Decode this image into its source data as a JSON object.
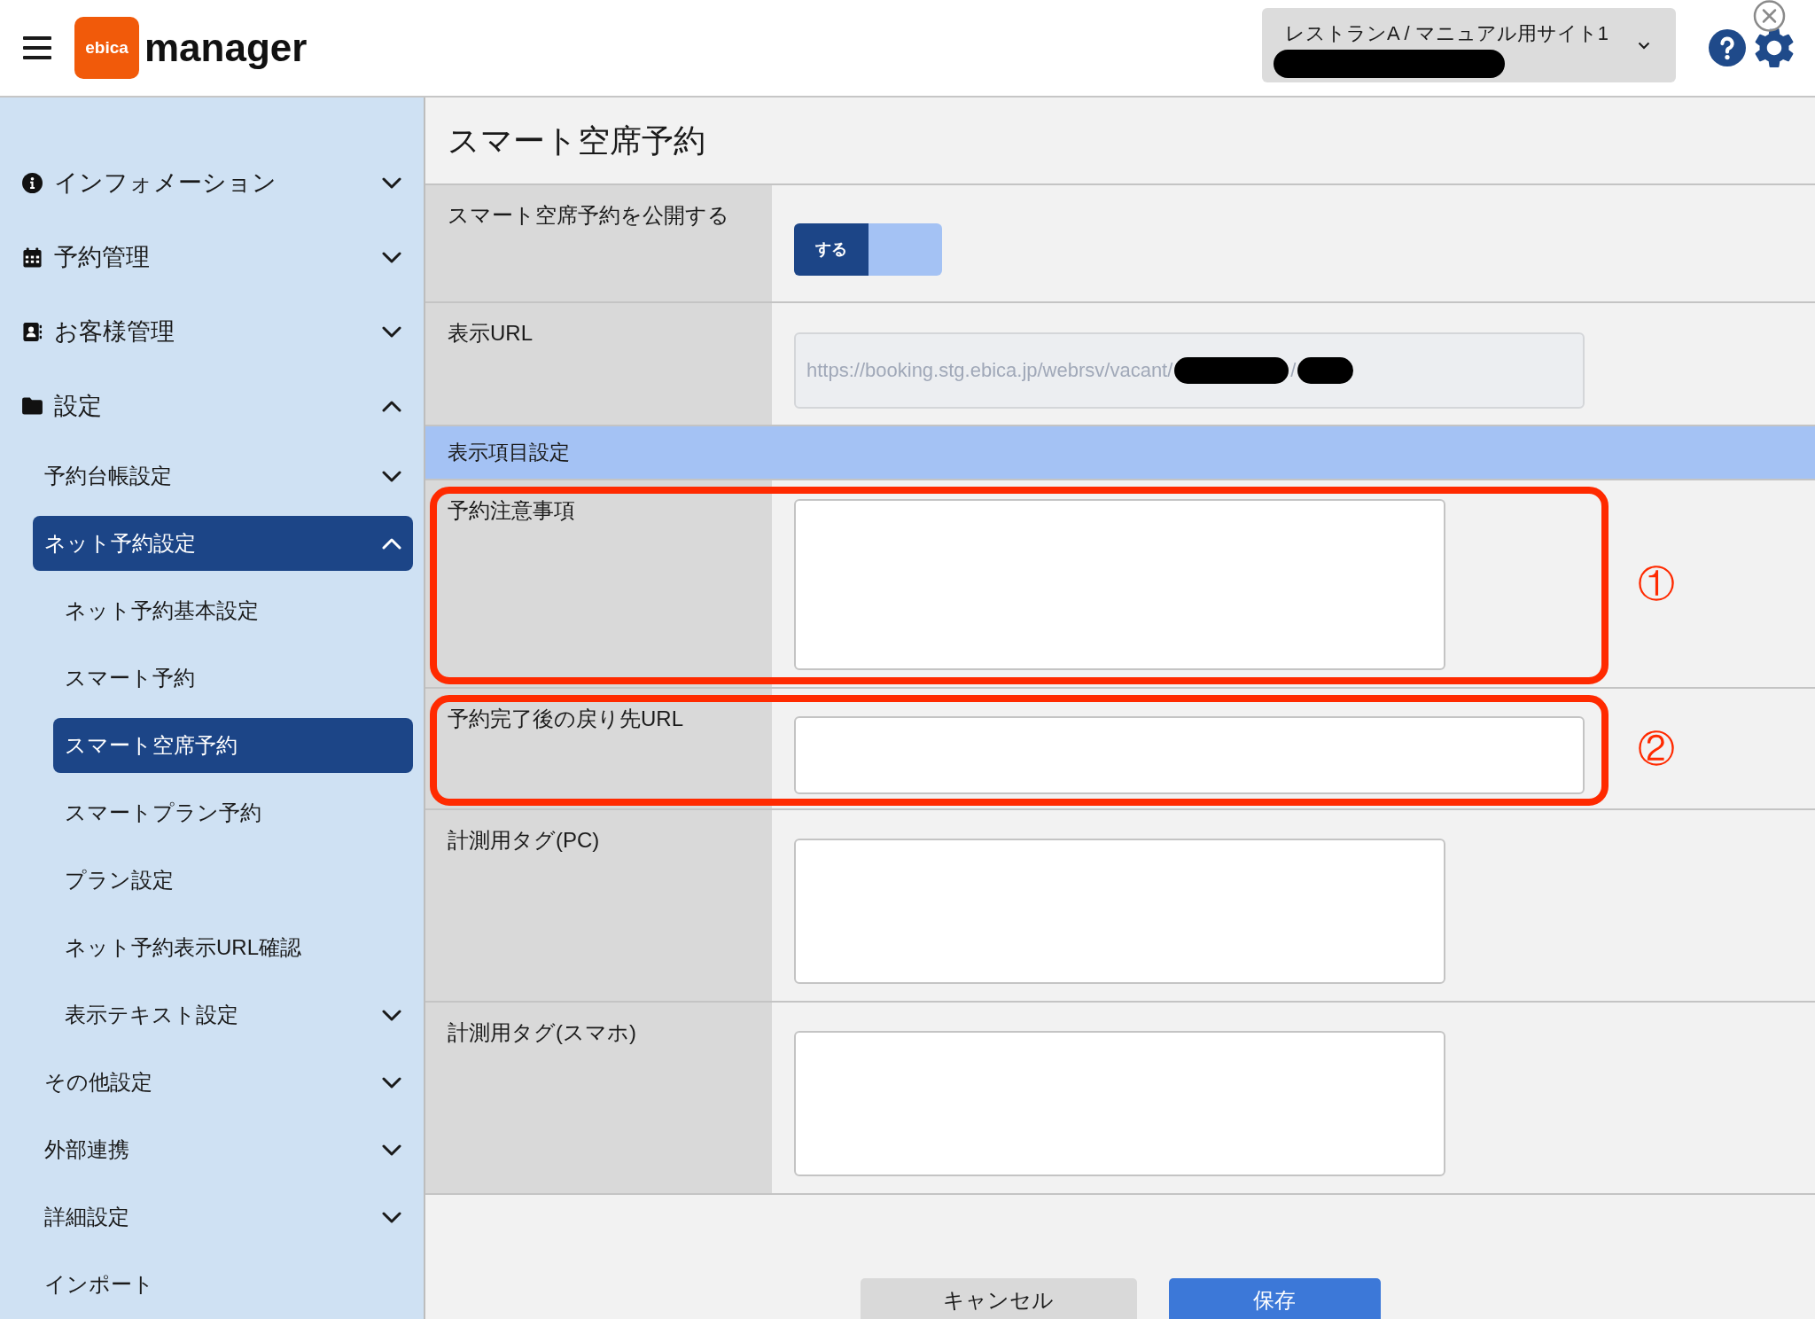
{
  "header": {
    "logo_text": "ebica",
    "app_name": "manager",
    "site_selector": {
      "label": "レストランA / マニュアル用サイト1",
      "redacted": true
    }
  },
  "sidebar": {
    "items": [
      {
        "label": "インフォメーション",
        "selected": false,
        "expanded": false
      },
      {
        "label": "予約管理",
        "selected": false,
        "expanded": false
      },
      {
        "label": "お客様管理",
        "selected": false,
        "expanded": false
      },
      {
        "label": "設定",
        "selected": false,
        "expanded": true,
        "children": [
          {
            "label": "予約台帳設定",
            "selected": false,
            "expanded": false
          },
          {
            "label": "ネット予約設定",
            "selected": true,
            "expanded": true,
            "children": [
              {
                "label": "ネット予約基本設定",
                "selected": false
              },
              {
                "label": "スマート予約",
                "selected": false
              },
              {
                "label": "スマート空席予約",
                "selected": true
              },
              {
                "label": "スマートプラン予約",
                "selected": false
              },
              {
                "label": "プラン設定",
                "selected": false
              },
              {
                "label": "ネット予約表示URL確認",
                "selected": false
              },
              {
                "label": "表示テキスト設定",
                "selected": false,
                "expanded": false
              }
            ]
          },
          {
            "label": "その他設定",
            "selected": false,
            "expanded": false
          },
          {
            "label": "外部連携",
            "selected": false,
            "expanded": false
          },
          {
            "label": "詳細設定",
            "selected": false,
            "expanded": false
          },
          {
            "label": "インポート",
            "selected": false
          }
        ]
      }
    ]
  },
  "page_title": "スマート空席予約",
  "settings_rows": [
    {
      "kind": "toggle",
      "label": "スマート空席予約を公開する",
      "toggle_label": "する",
      "on": true
    },
    {
      "kind": "url",
      "label": "表示URL",
      "value_segments": [
        {
          "kind": "text",
          "text": "https://booking.stg.ebica.jp/webrsv/vacant/"
        },
        {
          "kind": "redacted"
        },
        {
          "kind": "text",
          "text": "/"
        },
        {
          "kind": "redacted"
        }
      ]
    }
  ],
  "section_title": "表示項目設定",
  "display_fields": [
    {
      "kind": "textarea_tall",
      "label": "予約注意事項",
      "annotation": "①"
    },
    {
      "kind": "text",
      "label": "予約完了後の戻り先URL",
      "annotation": "②"
    },
    {
      "kind": "textarea",
      "label": "計測用タグ(PC)"
    },
    {
      "kind": "textarea",
      "label": "計測用タグ(スマホ)"
    }
  ],
  "buttons": [
    {
      "kind": "secondary",
      "label": "キャンセル"
    },
    {
      "kind": "primary",
      "label": "保存"
    }
  ]
}
